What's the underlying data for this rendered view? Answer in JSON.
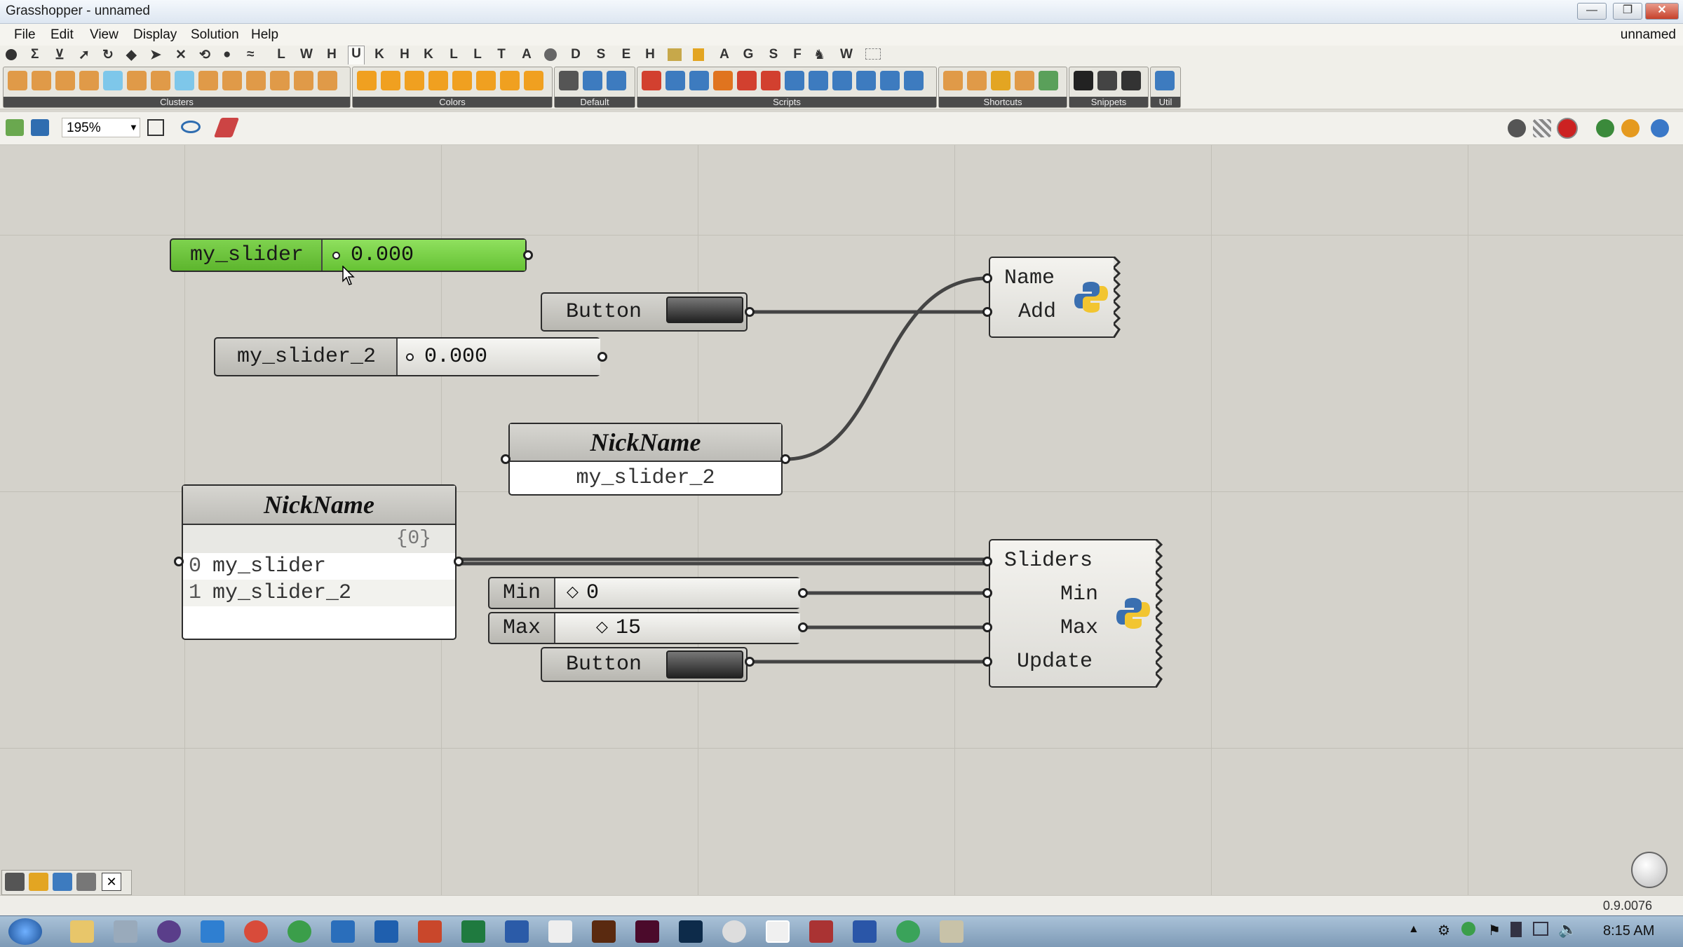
{
  "window": {
    "title": "Grasshopper - unnamed",
    "document": "unnamed",
    "controls": [
      "—",
      "❐",
      "✕"
    ]
  },
  "menu": [
    "File",
    "Edit",
    "View",
    "Display",
    "Solution",
    "Help"
  ],
  "tabs": [
    "L",
    "W",
    "H",
    "U",
    "K",
    "H",
    "K",
    "L",
    "L",
    "T",
    "A",
    "D",
    "S",
    "E",
    "H",
    "A",
    "G",
    "S",
    "F",
    "W"
  ],
  "ribbon_groups": [
    "Clusters",
    "Colors",
    "Default",
    "Scripts",
    "Shortcuts",
    "Snippets",
    "Util"
  ],
  "canvas_toolbar": {
    "zoom": "195%"
  },
  "components": {
    "slider1": {
      "name": "my_slider",
      "value": "0.000"
    },
    "button1": {
      "label": "Button"
    },
    "slider2": {
      "name": "my_slider_2",
      "value": "0.000"
    },
    "panel_small": {
      "title": "NickName",
      "value": "my_slider_2"
    },
    "panel_list": {
      "title": "NickName",
      "path": "{0}",
      "rows": [
        {
          "index": "0",
          "value": "my_slider"
        },
        {
          "index": "1",
          "value": "my_slider_2"
        }
      ]
    },
    "min_slider": {
      "name": "Min",
      "value": "0"
    },
    "max_slider": {
      "name": "Max",
      "value": "15"
    },
    "button2": {
      "label": "Button"
    },
    "python1": {
      "inputs": [
        "Name",
        "Add"
      ]
    },
    "python2": {
      "inputs": [
        "Sliders",
        "Min",
        "Max",
        "Update"
      ]
    }
  },
  "status": {
    "version": "0.9.0076"
  },
  "taskbar": {
    "time": "8:15 AM"
  },
  "colors": {
    "slider_active": "#6cc43a",
    "canvas": "#d4d2cb",
    "wire": "#444444"
  }
}
